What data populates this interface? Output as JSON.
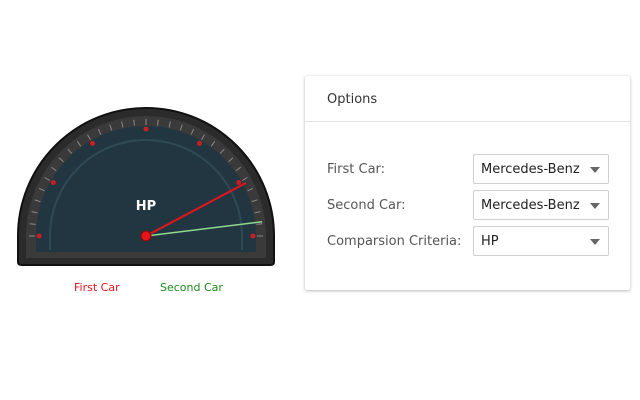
{
  "gauge": {
    "label": "HP",
    "needles": [
      {
        "name": "First Car",
        "color": "#e8141b",
        "angle_deg": 28
      },
      {
        "name": "Second Car",
        "color": "#8fd88f",
        "angle_deg": 7
      }
    ],
    "colors": {
      "face": "#233843",
      "rim": "#2d2d2d",
      "marker": "#c81e1e",
      "hub": "#e8141b"
    }
  },
  "legend": {
    "first": "First Car",
    "second": "Second Car"
  },
  "options": {
    "title": "Options",
    "rows": [
      {
        "label": "First Car:",
        "value": "Mercedes-Benz"
      },
      {
        "label": "Second Car:",
        "value": "Mercedes-Benz"
      },
      {
        "label": "Comparsion Criteria:",
        "value": "HP"
      }
    ]
  }
}
